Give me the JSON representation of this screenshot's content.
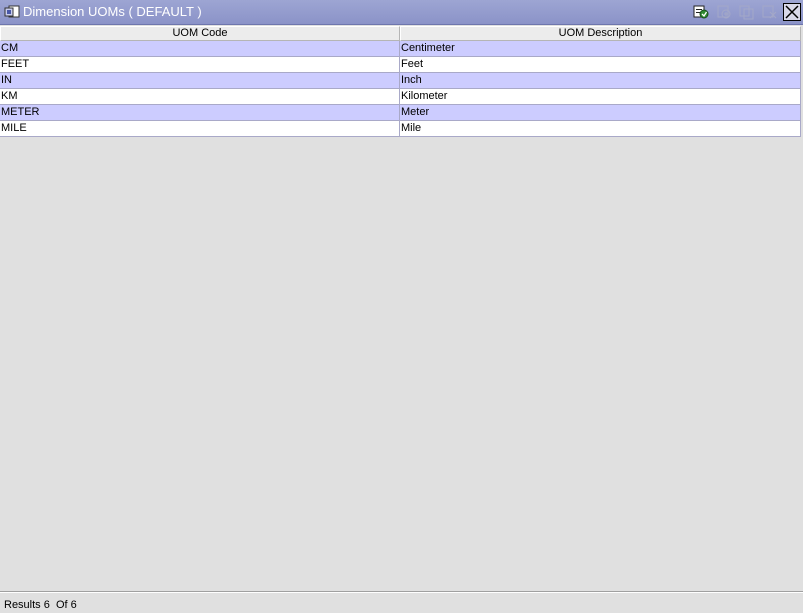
{
  "window": {
    "title": "Dimension UOMs ( DEFAULT )"
  },
  "toolbar": {
    "buttons": [
      {
        "icon": "details-icon",
        "enabled": true
      },
      {
        "icon": "create-icon",
        "enabled": false
      },
      {
        "icon": "copy-icon",
        "enabled": false
      },
      {
        "icon": "delete-icon",
        "enabled": false
      },
      {
        "icon": "close-icon",
        "enabled": true
      }
    ]
  },
  "grid": {
    "columns": [
      "UOM Code",
      "UOM Description"
    ],
    "rows": [
      {
        "code": "CM",
        "description": "Centimeter"
      },
      {
        "code": "FEET",
        "description": "Feet"
      },
      {
        "code": "IN",
        "description": "Inch"
      },
      {
        "code": "KM",
        "description": "Kilometer"
      },
      {
        "code": "METER",
        "description": "Meter"
      },
      {
        "code": "MILE",
        "description": "Mile"
      }
    ]
  },
  "status": {
    "text": "Results 6  Of 6"
  },
  "colors": {
    "titlebar": "#8b93c8",
    "row_alt": "#ccccff",
    "row_norm": "#ffffff",
    "background": "#e0e0e0"
  }
}
